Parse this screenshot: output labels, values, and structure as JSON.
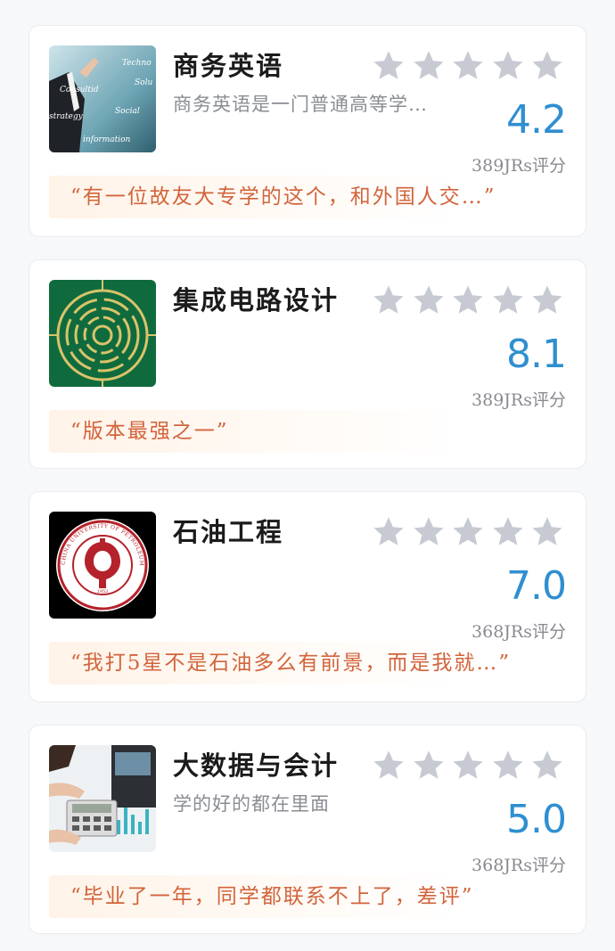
{
  "accent_color": "#2f8fd0",
  "quote_color": "#d2643b",
  "star_color": "#c7cad3",
  "majors": [
    {
      "name": "商务英语",
      "description": "商务英语是一门普通高等学…",
      "score": "4.2",
      "rating_count": "389JRs评分",
      "review": "有一位故友大专学的这个，和外国人交…",
      "rating_stars": 0,
      "thumbnail_icon": "business-english-photo",
      "thumbnail_words": [
        "Techno",
        "Solu",
        "Consultid",
        "Social",
        "information",
        "strategy"
      ]
    },
    {
      "name": "集成电路设计",
      "description": "",
      "score": "8.1",
      "rating_count": "389JRs评分",
      "review": "版本最强之一",
      "rating_stars": 0,
      "thumbnail_icon": "circuit-board-photo"
    },
    {
      "name": "石油工程",
      "description": "",
      "score": "7.0",
      "rating_count": "368JRs评分",
      "review": "我打5星不是石油多么有前景，而是我就…",
      "rating_stars": 0,
      "thumbnail_icon": "petroleum-university-logo",
      "thumbnail_logo_text": "CHINA UNIVERSITY OF PETROLEUM",
      "thumbnail_logo_year": "1953"
    },
    {
      "name": "大数据与会计",
      "description": "学的好的都在里面",
      "score": "5.0",
      "rating_count": "368JRs评分",
      "review": "毕业了一年，同学都联系不上了，差评",
      "rating_stars": 0,
      "thumbnail_icon": "accounting-calculator-photo"
    }
  ]
}
